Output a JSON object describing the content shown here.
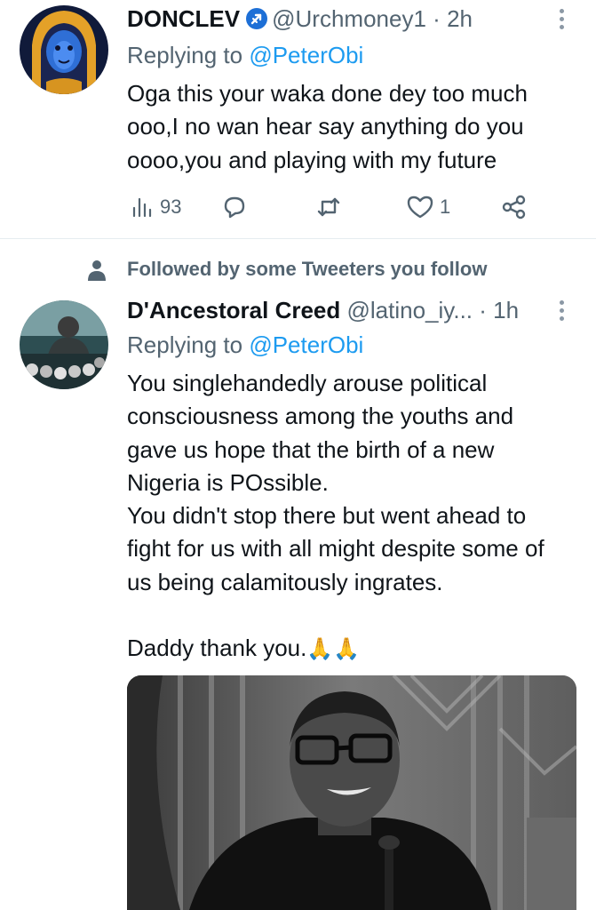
{
  "tweets": [
    {
      "display_name": "DONCLEV",
      "handle": "@Urchmoney1",
      "separator": "·",
      "time": "2h",
      "replying_prefix": "Replying to",
      "replying_to": "@PeterObi",
      "body_lines": [
        "Oga this your waka done dey too much",
        "ooo,I no wan hear say anything do you",
        "oooo,you and playing with my future"
      ],
      "actions": {
        "views": "93",
        "replies": "",
        "retweets": "",
        "likes": "1"
      }
    },
    {
      "social_context": "Followed by some Tweeters you follow",
      "display_name": "D'Ancestoral Creed",
      "handle": "@latino_iy...",
      "separator": "·",
      "time": "1h",
      "replying_prefix": "Replying to",
      "replying_to": "@PeterObi",
      "body_paragraphs": [
        "You singlehandedly arouse political consciousness among the youths and gave us hope that the birth of a new Nigeria is POssible.",
        "You didn't stop there but went ahead to fight for us with all might despite some of us being calamitously  ingrates.",
        "Daddy thank you."
      ],
      "emoji": "🙏🙏"
    }
  ],
  "colors": {
    "text_primary": "#0f1419",
    "text_secondary": "#536471",
    "link_blue": "#1d9bf0",
    "divider": "#e6ecf0"
  },
  "icons": {
    "views": "bar-chart-icon",
    "reply": "speech-bubble-icon",
    "retweet": "retweet-arrows-icon",
    "like": "heart-icon",
    "share": "share-nodes-icon",
    "verified_badge": "sagittarius-arrow-badge-icon",
    "follow_context": "person-icon",
    "more": "vertical-dots-icon"
  }
}
